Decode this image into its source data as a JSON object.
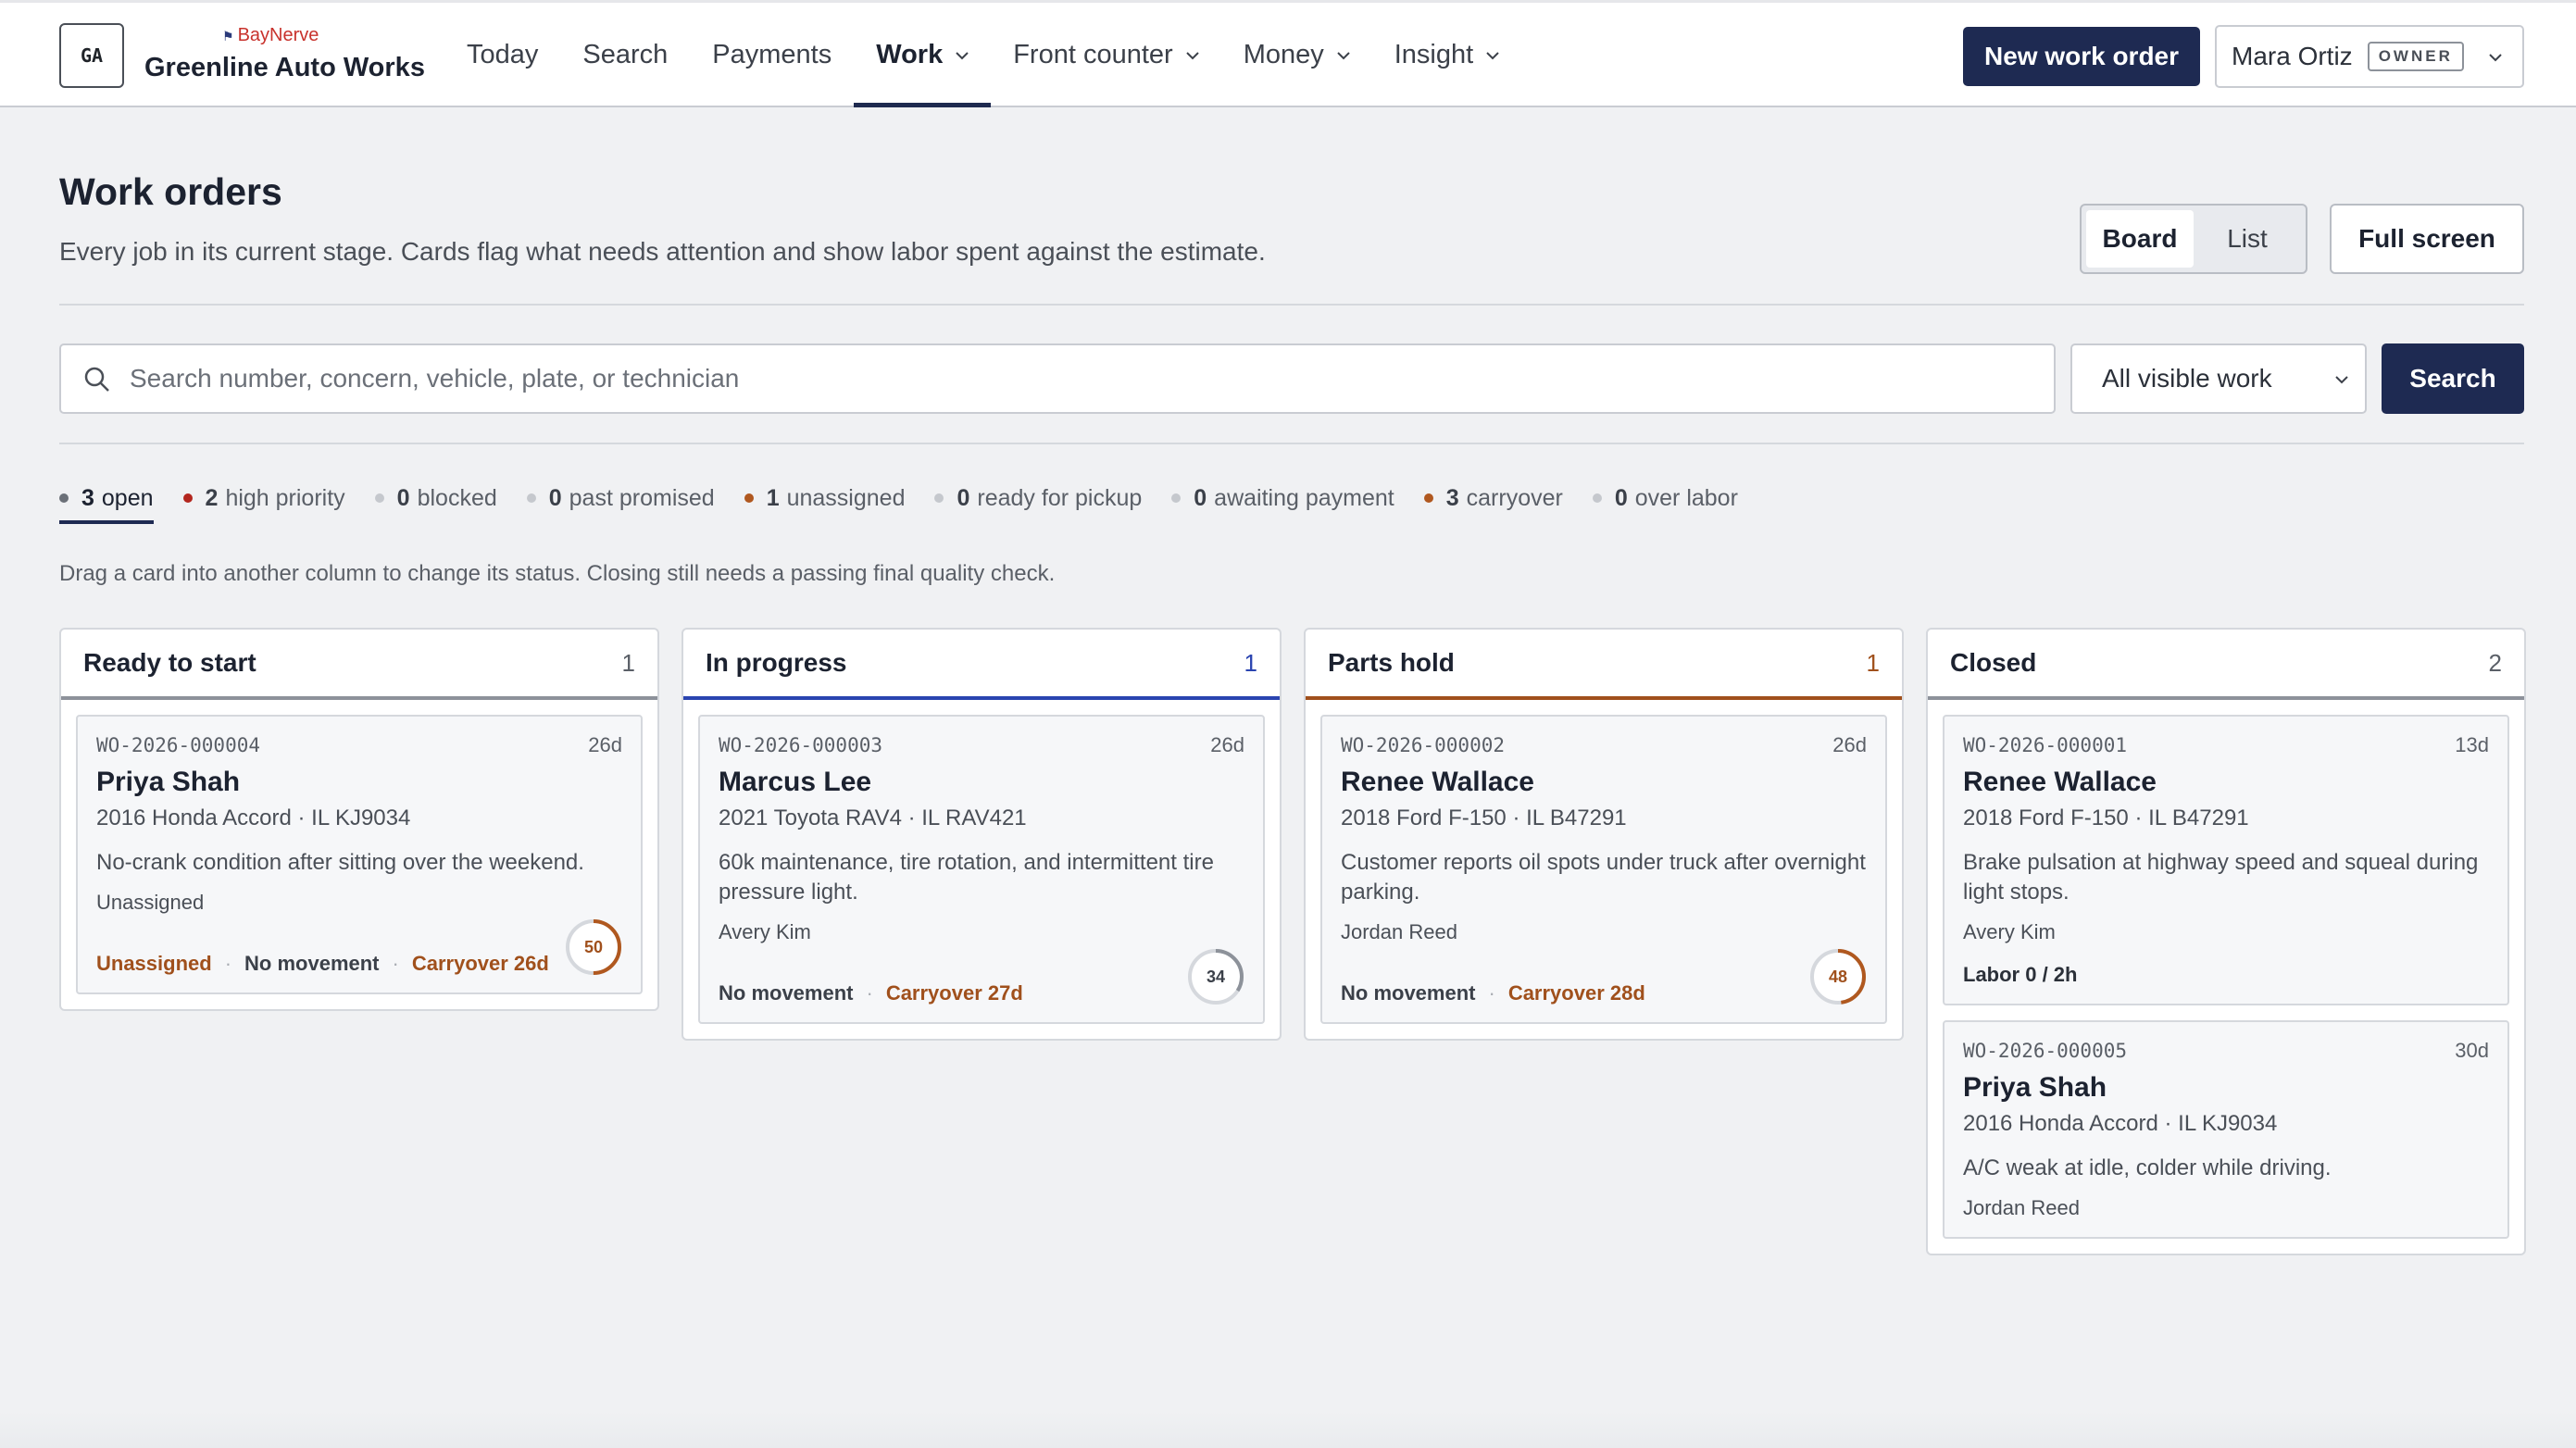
{
  "brand": {
    "badge": "GA",
    "tag": "BayNerve",
    "name": "Greenline Auto Works"
  },
  "nav": {
    "items": [
      {
        "label": "Today",
        "dropdown": false,
        "active": false
      },
      {
        "label": "Search",
        "dropdown": false,
        "active": false
      },
      {
        "label": "Payments",
        "dropdown": false,
        "active": false
      },
      {
        "label": "Work",
        "dropdown": true,
        "active": true
      },
      {
        "label": "Front counter",
        "dropdown": true,
        "active": false
      },
      {
        "label": "Money",
        "dropdown": true,
        "active": false
      },
      {
        "label": "Insight",
        "dropdown": true,
        "active": false
      }
    ],
    "new_work_order": "New work order",
    "user": {
      "name": "Mara Ortiz",
      "role": "OWNER"
    }
  },
  "page": {
    "title": "Work orders",
    "subtitle": "Every job in its current stage. Cards flag what needs attention and show labor spent against the estimate.",
    "view_board": "Board",
    "view_list": "List",
    "active_view": "Board",
    "full_screen": "Full screen"
  },
  "search": {
    "placeholder": "Search number, concern, vehicle, plate, or technician",
    "value": "",
    "scope_selected": "All visible work",
    "button": "Search"
  },
  "filters": [
    {
      "count": "3",
      "label": "open",
      "dot": "#6b7078",
      "active": true
    },
    {
      "count": "2",
      "label": "high priority",
      "dot": "#b3261e",
      "active": false
    },
    {
      "count": "0",
      "label": "blocked",
      "dot": "#c5c8cd",
      "active": false
    },
    {
      "count": "0",
      "label": "past promised",
      "dot": "#c5c8cd",
      "active": false
    },
    {
      "count": "1",
      "label": "unassigned",
      "dot": "#b0581f",
      "active": false
    },
    {
      "count": "0",
      "label": "ready for pickup",
      "dot": "#c5c8cd",
      "active": false
    },
    {
      "count": "0",
      "label": "awaiting payment",
      "dot": "#c5c8cd",
      "active": false
    },
    {
      "count": "3",
      "label": "carryover",
      "dot": "#b0581f",
      "active": false
    },
    {
      "count": "0",
      "label": "over labor",
      "dot": "#c5c8cd",
      "active": false
    }
  ],
  "hint": "Drag a card into another column to change its status. Closing still needs a passing final quality check.",
  "columns": [
    {
      "title": "Ready to start",
      "count": "1",
      "accent": "#8d929a",
      "count_color": "#5a5f67",
      "cards": [
        {
          "number": "WO-2026-000004",
          "age": "26d",
          "customer": "Priya Shah",
          "vehicle": "2016 Honda Accord · IL KJ9034",
          "concern": "No-crank condition after sitting over the weekend.",
          "technician": "Unassigned",
          "labor": "",
          "flags": [
            {
              "text": "Unassigned",
              "warn": true
            },
            {
              "text": "No movement",
              "warn": false
            },
            {
              "text": "Carryover 26d",
              "warn": true
            }
          ],
          "progress": 50,
          "progress_warn": true
        }
      ]
    },
    {
      "title": "In progress",
      "count": "1",
      "accent": "#2a44b0",
      "count_color": "#2a44b0",
      "cards": [
        {
          "number": "WO-2026-000003",
          "age": "26d",
          "customer": "Marcus Lee",
          "vehicle": "2021 Toyota RAV4 · IL RAV421",
          "concern": "60k maintenance, tire rotation, and intermittent tire pressure light.",
          "technician": "Avery Kim",
          "labor": "",
          "flags": [
            {
              "text": "No movement",
              "warn": false
            },
            {
              "text": "Carryover 27d",
              "warn": true
            }
          ],
          "progress": 34,
          "progress_warn": false
        }
      ]
    },
    {
      "title": "Parts hold",
      "count": "1",
      "accent": "#a0501c",
      "count_color": "#a0501c",
      "cards": [
        {
          "number": "WO-2026-000002",
          "age": "26d",
          "customer": "Renee Wallace",
          "vehicle": "2018 Ford F-150 · IL B47291",
          "concern": "Customer reports oil spots under truck after overnight parking.",
          "technician": "Jordan Reed",
          "labor": "",
          "flags": [
            {
              "text": "No movement",
              "warn": false
            },
            {
              "text": "Carryover 28d",
              "warn": true
            }
          ],
          "progress": 48,
          "progress_warn": true
        }
      ]
    },
    {
      "title": "Closed",
      "count": "2",
      "accent": "#8d929a",
      "count_color": "#5a5f67",
      "cards": [
        {
          "number": "WO-2026-000001",
          "age": "13d",
          "customer": "Renee Wallace",
          "vehicle": "2018 Ford F-150 · IL B47291",
          "concern": "Brake pulsation at highway speed and squeal during light stops.",
          "technician": "Avery Kim",
          "labor": "Labor 0 / 2h",
          "flags": [],
          "progress": null,
          "progress_warn": false
        },
        {
          "number": "WO-2026-000005",
          "age": "30d",
          "customer": "Priya Shah",
          "vehicle": "2016 Honda Accord · IL KJ9034",
          "concern": "A/C weak at idle, colder while driving.",
          "technician": "Jordan Reed",
          "labor": "",
          "flags": [],
          "progress": null,
          "progress_warn": false
        }
      ]
    }
  ]
}
